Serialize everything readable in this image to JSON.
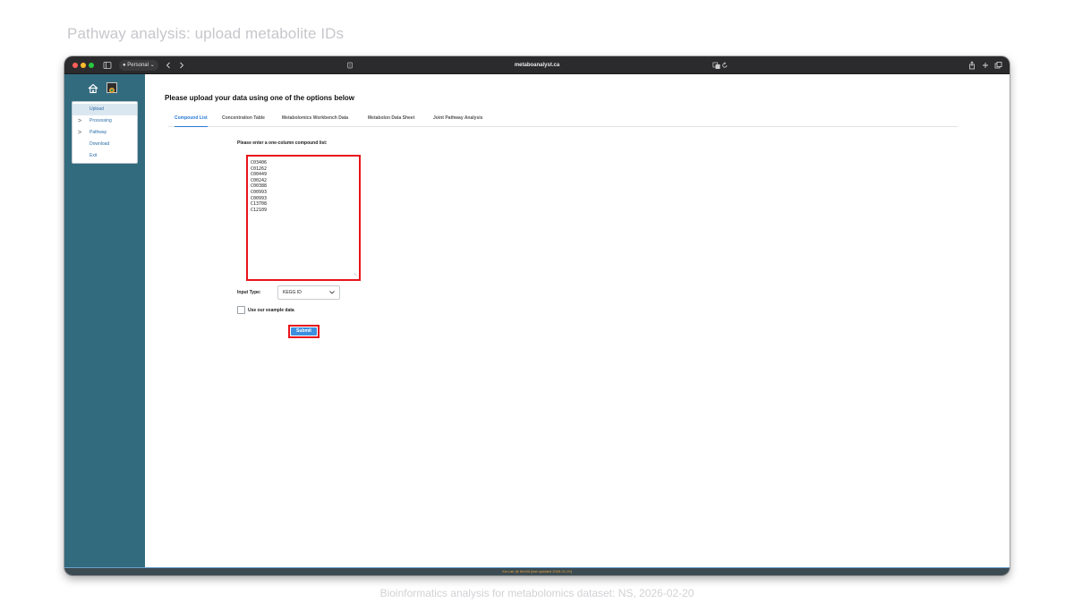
{
  "slide": {
    "title": "Pathway analysis: upload metabolite IDs",
    "caption": "Bioinformatics analysis for metabolomics dataset: NS, 2026-02-20"
  },
  "browser": {
    "profile_label": "Personal",
    "url": "metaboanalyst.ca",
    "icons": [
      "sidebar-toggle-icon",
      "back-icon",
      "forward-icon",
      "reader-icon",
      "translate-icon",
      "reload-icon",
      "share-icon",
      "new-tab-icon",
      "tab-overview-icon"
    ]
  },
  "sidebar": {
    "items": [
      {
        "label": "Upload",
        "active": true
      },
      {
        "label": "Processing",
        "chevron": ">"
      },
      {
        "label": "Pathway",
        "chevron": ">"
      },
      {
        "label": "Download"
      },
      {
        "label": "Exit"
      }
    ]
  },
  "main": {
    "heading": "Please upload your data using one of the options below",
    "tabs": [
      {
        "label": "Compound List",
        "active": true
      },
      {
        "label": "Concentration Table"
      },
      {
        "label": "Metabolomics Workbench Data"
      },
      {
        "label": "Metabolon Data Sheet"
      },
      {
        "label": "Joint Pathway Analysis"
      }
    ],
    "list_label": "Please enter a one-column compound list:",
    "compounds": [
      "C03406",
      "C01262",
      "C00449",
      "C00242",
      "C00388",
      "C00993",
      "C00993",
      "C13708",
      "C12109"
    ],
    "input_type_label": "Input Type:",
    "input_type_value": "KEGG ID",
    "example_label": "Use our example data",
    "submit_label": "Submit"
  },
  "footer": {
    "text": "Xia Lab @ McGill (last updated 2026-01-20)"
  },
  "colors": {
    "sidebar": "#336b7e",
    "highlight": "#e8141a",
    "accent": "#2a7bd4",
    "button": "#3d8fe0"
  }
}
